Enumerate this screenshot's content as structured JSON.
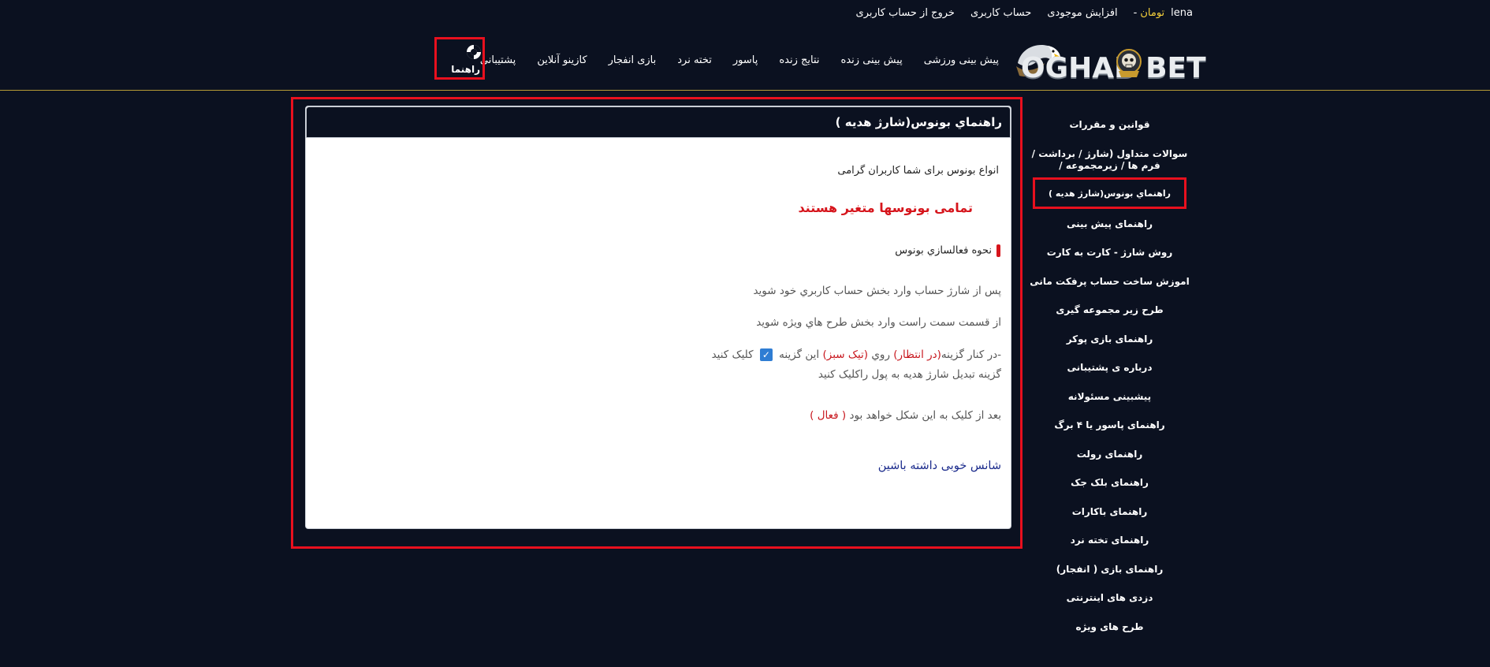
{
  "topbar": {
    "username": "lena",
    "currency": "تومان",
    "dash": "-",
    "links": [
      "افزایش موجودی",
      "حساب کاربری",
      "خروج از حساب کاربری"
    ]
  },
  "header": {
    "logo_text": "OGHAB BET",
    "nav": [
      "پیش بینی ورزشی",
      "پیش بینی زنده",
      "نتایج زنده",
      "پاسور",
      "تخته نرد",
      "بازی انفجار",
      "کازینو آنلاین",
      "پشتیبانی"
    ],
    "help_label": "راهنما"
  },
  "sidebar": {
    "items": [
      "قوانین و مقررات",
      "سوالات متداول (شارژ / برداشت / فرم ها / زیرمجموعه /",
      "راهنماي بونوس(شارژ هديه )",
      "راهنمای پیش بینی",
      "روش شارژ - کارت به کارت",
      "اموزش ساخت حساب پرفکت مانی",
      "طرح زیر مجموعه گیری",
      "راهنمای بازی پوکر",
      "درباره ی پشتیبانی",
      "پیشبینی مسئولانه",
      "راهنمای پاسور یا ۴ برگ",
      "راهنمای رولت",
      "راهنمای بلک جک",
      "راهنمای باکارات",
      "راهنمای تخته نرد",
      "راهنمای بازی ( انفجار)",
      "دزدی های اینترنتی",
      "طرح های ویژه"
    ]
  },
  "content": {
    "title": "راهنماي بونوس(شارژ هديه )",
    "intro": "انواع بونوس برای شما کاربران گرامی",
    "warning": "تمامی بونوسها متغیر هستند",
    "activate_heading": "نحوه فعالسازي بونوس",
    "step1": "پس از شارژ حساب وارد بخش حساب کاربري خود  شويد",
    "step2": "از قسمت سمت راست وارد بخش طرح هاي ويژه شويد",
    "step3_a": "-در کنار گزينه",
    "step3_b": "(در انتظار)",
    "step3_c": " روي ",
    "step3_d": "(تيک سبز)",
    "step3_e": " اين گزينه ",
    "step3_f": " کليک کنيد",
    "step3_line2": "گزينه تبديل شارژ هديه به پول راکليک کنيد",
    "step4_a": "بعد از کليک به اين شکل خواهد بود ",
    "step4_b": "( فعال )",
    "luck": "شانس خوبی داشته باشین"
  },
  "colors": {
    "background": "#0b1120",
    "accent_red": "#e8101e",
    "currency_yellow": "#f5d03b",
    "divider_gold": "#b59a36",
    "link_blue": "#1b2b8c"
  }
}
